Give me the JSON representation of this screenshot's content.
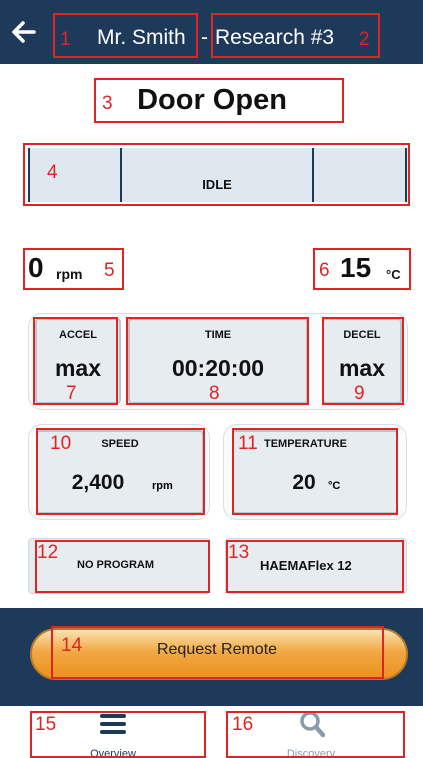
{
  "header": {
    "user": "Mr. Smith",
    "separator": "-",
    "device_name": "Research #3"
  },
  "status_title": "Door Open",
  "phase": {
    "current": "IDLE"
  },
  "readings": {
    "speed_value": "0",
    "speed_unit": "rpm",
    "temp_value": "15",
    "temp_unit": "°C"
  },
  "profile": {
    "accel_label": "ACCEL",
    "accel_value": "max",
    "time_label": "TIME",
    "time_value": "00:20:00",
    "decel_label": "DECEL",
    "decel_value": "max"
  },
  "setpoints": {
    "speed_label": "SPEED",
    "speed_value": "2,400",
    "speed_unit": "rpm",
    "temp_label": "TEMPERATURE",
    "temp_value": "20",
    "temp_unit": "°C"
  },
  "program": "NO PROGRAM",
  "rotor": "HAEMAFlex 12",
  "remote_button": "Request Remote",
  "nav": {
    "overview_label": "Overview",
    "discovery_label": "Discovery"
  },
  "annotations": [
    "1",
    "2",
    "3",
    "4",
    "5",
    "6",
    "7",
    "8",
    "9",
    "10",
    "11",
    "12",
    "13",
    "14",
    "15",
    "16"
  ],
  "colors": {
    "header_bg": "#1d3a5a",
    "annotation": "#e02424",
    "button_orange": "#f2a844",
    "card_bg": "#e7ecf1",
    "nav_active": "#1d3a5a",
    "nav_inactive": "#8a9aa9"
  }
}
